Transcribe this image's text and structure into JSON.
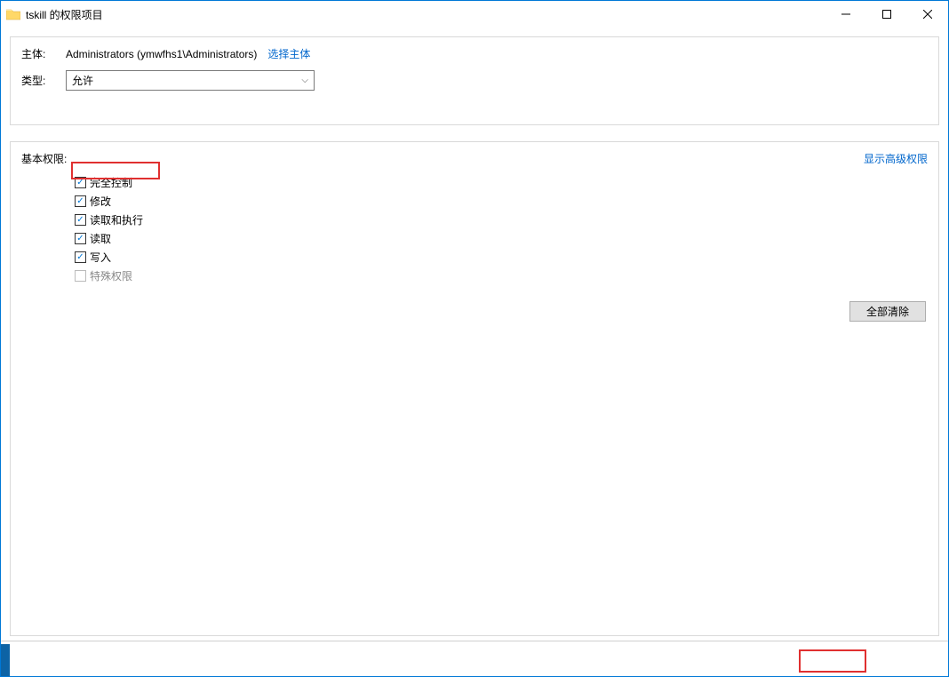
{
  "window": {
    "title": "tskill 的权限项目"
  },
  "principal": {
    "label": "主体:",
    "value": "Administrators (ymwfhs1\\Administrators)",
    "select_link": "选择主体"
  },
  "type": {
    "label": "类型:",
    "value": "允许"
  },
  "permissions": {
    "title": "基本权限:",
    "advanced_link": "显示高级权限",
    "items": [
      {
        "label": "完全控制",
        "checked": true,
        "disabled": false
      },
      {
        "label": "修改",
        "checked": true,
        "disabled": false
      },
      {
        "label": "读取和执行",
        "checked": true,
        "disabled": false
      },
      {
        "label": "读取",
        "checked": true,
        "disabled": false
      },
      {
        "label": "写入",
        "checked": true,
        "disabled": false
      },
      {
        "label": "特殊权限",
        "checked": false,
        "disabled": true
      }
    ],
    "clear_all": "全部清除"
  }
}
